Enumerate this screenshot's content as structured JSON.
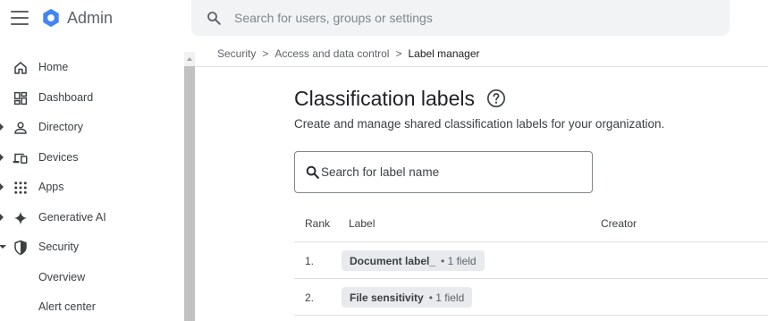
{
  "app": {
    "brand": "Admin",
    "search_placeholder": "Search for users, groups or settings"
  },
  "colors": {
    "accent": "#1a73e8",
    "logo_blue": "#4285f4"
  },
  "sidebar": {
    "items": [
      {
        "label": "Home",
        "icon": "home-icon",
        "expandable": false
      },
      {
        "label": "Dashboard",
        "icon": "dashboard-icon",
        "expandable": false
      },
      {
        "label": "Directory",
        "icon": "person-icon",
        "expandable": true
      },
      {
        "label": "Devices",
        "icon": "devices-icon",
        "expandable": true
      },
      {
        "label": "Apps",
        "icon": "apps-grid-icon",
        "expandable": true
      },
      {
        "label": "Generative AI",
        "icon": "sparkle-icon",
        "expandable": true
      },
      {
        "label": "Security",
        "icon": "shield-icon",
        "expanded": true
      }
    ],
    "subitems": [
      {
        "label": "Overview"
      },
      {
        "label": "Alert center"
      }
    ]
  },
  "breadcrumb": {
    "items": [
      "Security",
      "Access and data control"
    ],
    "current": "Label manager"
  },
  "main": {
    "title": "Classification labels",
    "subtitle": "Create and manage shared classification labels for your organization.",
    "label_search_placeholder": "Search for label name",
    "table": {
      "headers": {
        "rank": "Rank",
        "label": "Label",
        "creator": "Creator"
      },
      "rows": [
        {
          "rank": "1.",
          "label": "Document label_",
          "meta": "• 1 field"
        },
        {
          "rank": "2.",
          "label": "File sensitivity",
          "meta": "• 1 field"
        }
      ]
    }
  }
}
